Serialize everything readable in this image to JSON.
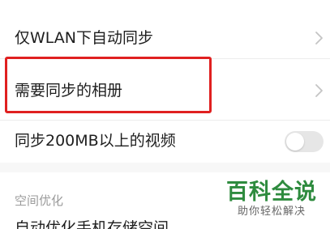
{
  "settings": {
    "rows": [
      {
        "label": "仅WLAN下自动同步"
      },
      {
        "label": "需要同步的相册"
      },
      {
        "label": "同步200MB以上的视频",
        "toggle_on": false
      }
    ],
    "section_header": "空间优化",
    "cutoff_row_label": "自动优化手机存储空间"
  },
  "watermark": {
    "main": "百科全说",
    "sub": "助你轻松解决"
  },
  "colors": {
    "highlight": "#e02020",
    "watermark_green": "#2e8b3e",
    "toggle_off": "#e6e6e6"
  },
  "icons": {
    "row_chevron": "chevron-right-icon"
  }
}
